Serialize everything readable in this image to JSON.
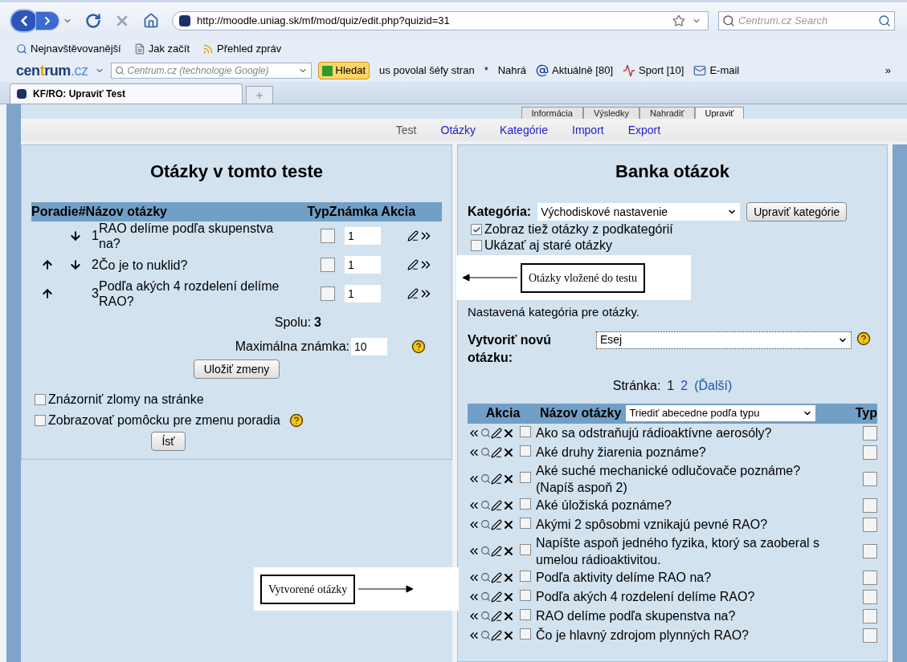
{
  "browser": {
    "url": "http://moodle.uniag.sk/mf/mod/quiz/edit.php?quizid=31",
    "search_placeholder": "Centrum.cz Search",
    "bookmarks": [
      {
        "label": "Nejnavštěvovanější",
        "kind": "search"
      },
      {
        "label": "Jak začít",
        "kind": "page"
      },
      {
        "label": "Přehled zpráv",
        "kind": "rss"
      }
    ],
    "toolbar": {
      "logo_left": "cen",
      "logo_mid": "t",
      "logo_right": "rum",
      "logo_tld": ".cz",
      "search_placeholder": "Centrum.cz (technologie Google)",
      "search_button": "Hledat",
      "items": [
        {
          "label": "us povolal šéfy stran",
          "kind": "text"
        },
        {
          "label": "*",
          "kind": "text"
        },
        {
          "label": "Nahrá",
          "kind": "text"
        },
        {
          "label": "Aktuálně [80]",
          "kind": "news"
        },
        {
          "label": "Sport [10]",
          "kind": "sport"
        },
        {
          "label": "E-mail",
          "kind": "mail"
        }
      ],
      "more": "»"
    },
    "tab": {
      "title": "KF/RO: Upraviť Test"
    }
  },
  "moodle_tabs": [
    {
      "label": "Informácia",
      "selected": false
    },
    {
      "label": "Výsledky",
      "selected": false
    },
    {
      "label": "Nahradiť",
      "selected": false
    },
    {
      "label": "Upraviť",
      "selected": true
    }
  ],
  "subtabs": [
    {
      "label": "Test",
      "selected": true
    },
    {
      "label": "Otázky",
      "selected": false
    },
    {
      "label": "Kategórie",
      "selected": false
    },
    {
      "label": "Import",
      "selected": false
    },
    {
      "label": "Export",
      "selected": false
    }
  ],
  "quiz_panel": {
    "title": "Otázky v tomto teste",
    "columns": [
      "Poradie",
      "#",
      "Názov otázky",
      "Typ",
      "Známka",
      "Akcia"
    ],
    "rows": [
      {
        "number": "1",
        "name": "RAO delíme podľa skupenstva na?",
        "can_move_up": false,
        "can_move_down": true,
        "checked": false,
        "grade": "1"
      },
      {
        "number": "2",
        "name": "Čo je to nuklid?",
        "can_move_up": true,
        "can_move_down": true,
        "checked": false,
        "grade": "1"
      },
      {
        "number": "3",
        "name": "Podľa akých 4 rozdelení delíme RAO?",
        "can_move_up": true,
        "can_move_down": false,
        "checked": false,
        "grade": "1"
      }
    ],
    "total_label": "Spolu:",
    "total": "3",
    "max_label": "Maximálna známka:",
    "max_grade": "10",
    "save_button": "Uložiť zmeny",
    "options": [
      {
        "label": "Znázorniť zlomy na stránke",
        "checked": false,
        "help": false
      },
      {
        "label": "Zobrazovať pomôcku pre zmenu poradia",
        "checked": false,
        "help": true
      }
    ],
    "go_button": "Ísť"
  },
  "bank_panel": {
    "title": "Banka otázok",
    "category_label": "Kategória:",
    "category": "Východiskové nastavenie",
    "edit_categories": "Upraviť kategórie",
    "options": [
      {
        "label": "Zobraz tiež otázky z podkategórií",
        "checked": true
      },
      {
        "label": "Ukázať aj staré otázky",
        "checked": false
      }
    ],
    "note": "Nastavená kategória pre otázky.",
    "create_label": "Vytvoriť novú otázku:",
    "create_type": "Esej",
    "pager_label": "Stránka:",
    "pages": [
      {
        "label": "1",
        "selected": true
      },
      {
        "label": "2",
        "selected": false
      }
    ],
    "next": "(Ďalší)",
    "columns": [
      "Akcia",
      "Názov otázky",
      "Typ"
    ],
    "sort": "Triediť abecedne podľa typu",
    "rows": [
      {
        "name": "Ako sa odstraňujú rádioaktívne aerosóly?",
        "checked": false,
        "type_checked": false
      },
      {
        "name": "Aké druhy žiarenia poznáme?",
        "checked": false,
        "type_checked": false
      },
      {
        "name": "Aké suché mechanické odlučovače poznáme? (Napíš aspoň 2)",
        "checked": false,
        "type_checked": false
      },
      {
        "name": "Aké úložiská poznáme?",
        "checked": false,
        "type_checked": false
      },
      {
        "name": "Akými 2 spôsobmi vznikajú pevné RAO?",
        "checked": false,
        "type_checked": false
      },
      {
        "name": "Napíšte aspoň jedného fyzika, ktorý sa zaoberal s umelou rádioaktivitou.",
        "checked": false,
        "type_checked": false
      },
      {
        "name": "Podľa aktivity delíme RAO na?",
        "checked": false,
        "type_checked": false
      },
      {
        "name": "Podľa akých 4 rozdelení delíme RAO?",
        "checked": false,
        "type_checked": false
      },
      {
        "name": "RAO delíme podľa skupenstva na?",
        "checked": false,
        "type_checked": false
      },
      {
        "name": "Čo je hlavný zdrojom plynných RAO?",
        "checked": false,
        "type_checked": false
      }
    ]
  },
  "callouts": [
    {
      "text": "Otázky vložené do testu",
      "kind": "left_arrow"
    },
    {
      "text": "Vytvorené otázky",
      "kind": "right_arrow"
    }
  ]
}
